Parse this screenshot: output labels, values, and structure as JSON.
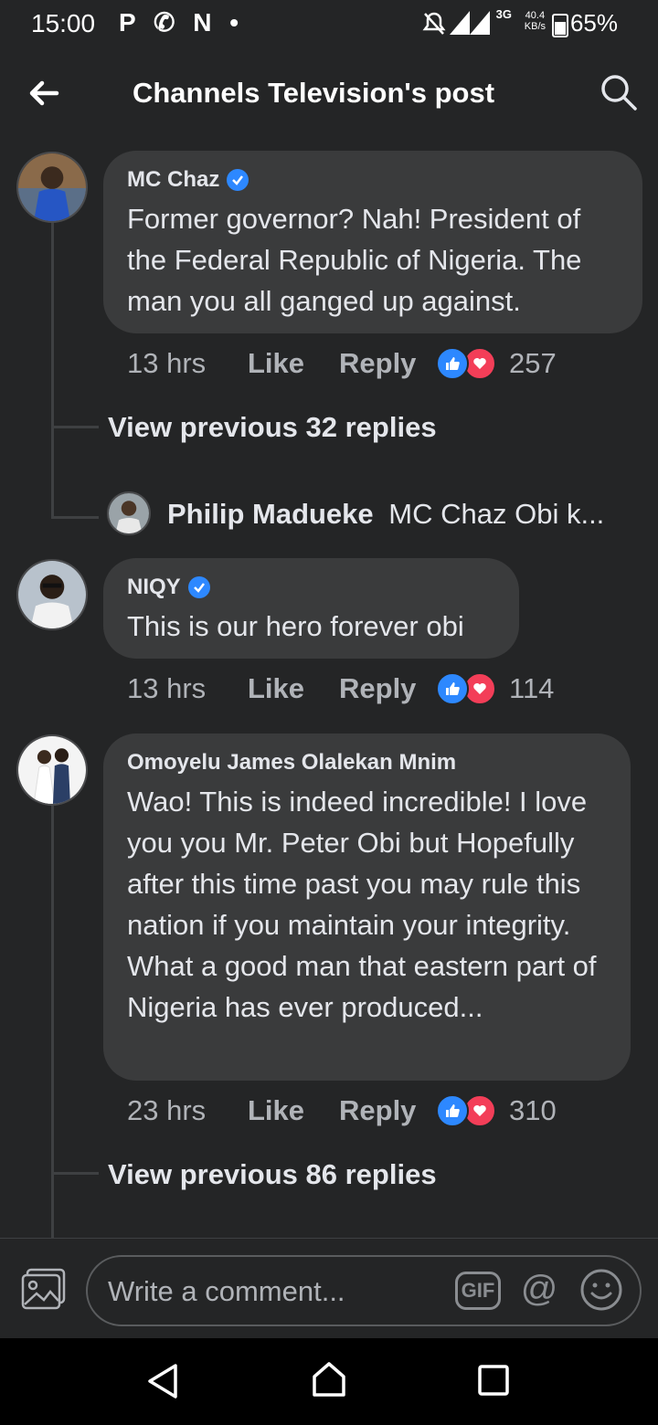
{
  "status_bar": {
    "time": "15:00",
    "app_icons": "P ✆ N •",
    "network": "3G",
    "speed": "40.4\nKB/s",
    "battery": "65%"
  },
  "header": {
    "title": "Channels Television's post"
  },
  "comments": [
    {
      "author": "MC Chaz",
      "verified": true,
      "text": "Former governor? Nah! President of the Federal Republic of Nigeria. The man you all ganged up against.",
      "time": "13 hrs",
      "like_label": "Like",
      "reply_label": "Reply",
      "reaction_count": "257",
      "view_previous": "View previous 32 replies",
      "reply_preview": {
        "author": "Philip Madueke",
        "text": "MC Chaz Obi k..."
      }
    },
    {
      "author": "NIQY",
      "verified": true,
      "text": "This is our hero forever obi",
      "time": "13 hrs",
      "like_label": "Like",
      "reply_label": "Reply",
      "reaction_count": "114"
    },
    {
      "author": "Omoyelu James Olalekan Mnim",
      "verified": false,
      "text": "Wao! This is indeed incredible! I love you you Mr. Peter Obi but Hopefully after this time past you may rule this nation if you maintain your integrity.\nWhat a good man that eastern part of Nigeria has ever produced...",
      "time": "23 hrs",
      "like_label": "Like",
      "reply_label": "Reply",
      "reaction_count": "310",
      "view_previous": "View previous 86 replies"
    }
  ],
  "composer": {
    "placeholder": "Write a comment...",
    "gif_label": "GIF",
    "at_label": "@"
  },
  "icons": {
    "back": "arrow-left-icon",
    "search": "search-icon",
    "photo": "photo-icon",
    "emoji": "emoji-icon",
    "nav_back": "triangle-back-icon",
    "nav_home": "home-icon",
    "nav_recents": "square-recents-icon"
  },
  "colors": {
    "background": "#242526",
    "bubble": "#3a3b3c",
    "like_blue": "#2d88ff",
    "love_red": "#f33e58"
  }
}
